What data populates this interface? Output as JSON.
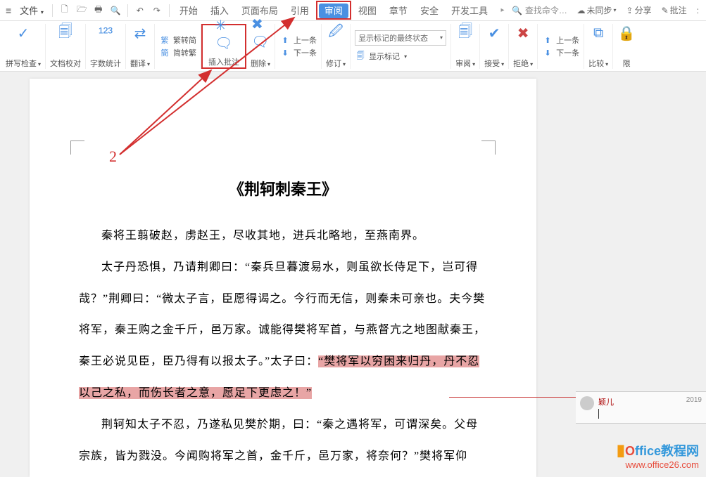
{
  "menubar": {
    "file": "文件",
    "tabs": [
      "开始",
      "插入",
      "页面布局",
      "引用",
      "审阅",
      "视图",
      "章节",
      "安全",
      "开发工具"
    ],
    "active_tab_index": 4,
    "search_placeholder": "查找命令…",
    "right": {
      "sync": "未同步",
      "share": "分享",
      "comment": "批注"
    }
  },
  "ribbon": {
    "spellcheck": "拼写检查",
    "docproof": "文档校对",
    "wordcount": "字数统计",
    "translate": "翻译",
    "convert": {
      "t2s": "繁转简",
      "s2t": "简转繁"
    },
    "insert_comment": "插入批注",
    "delete": "删除",
    "nav": {
      "prev": "上一条",
      "next": "下一条"
    },
    "track": "修订",
    "track_display": {
      "combo": "显示标记的最终状态",
      "show": "显示标记"
    },
    "review": "审阅",
    "accept": "接受",
    "reject": "拒绝",
    "nav2": {
      "prev": "上一条",
      "next": "下一条"
    },
    "compare": "比较",
    "restrict": "限"
  },
  "document": {
    "title": "《荆轲刺秦王》",
    "p1": "秦将王翦破赵，虏赵王，尽收其地，进兵北略地，至燕南界。",
    "p2a": "太子丹恐惧，乃请荆卿曰：“秦兵旦暮渡易水，则虽欲长侍足下，岂可得哉？”荆卿曰：“微太子言，臣愿得谒之。今行而无信，则秦未可亲也。夫今樊将军，秦王购之金千斤，邑万家。诚能得樊将军首，与燕督亢之地图献秦王，秦王必说见臣，臣乃得有以报太子。”太子曰：",
    "p2b": "“樊将军以穷困来归丹，丹不忍以己之私，而伤长者之意，愿足下更虑之！”",
    "p3": "荆轲知太子不忍，乃遂私见樊於期，曰：“秦之遇将军，可谓深矣。父母宗族，皆为戮没。今闻购将军之首，金千斤，邑万家，将奈何？”樊将军仰"
  },
  "comment": {
    "author": "颖儿",
    "date": "2019"
  },
  "annotation": {
    "num": "2"
  },
  "watermark": {
    "brand_text": "ffice教程网",
    "url": "www.office26.com"
  }
}
